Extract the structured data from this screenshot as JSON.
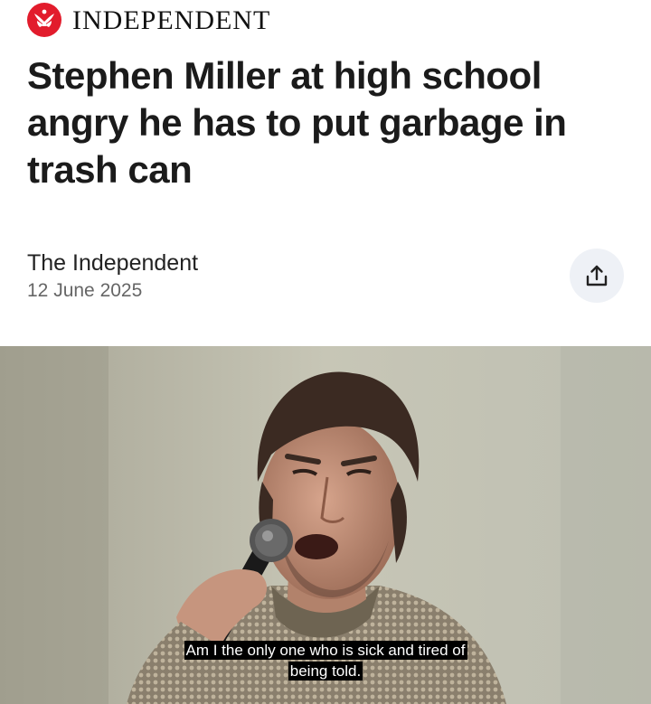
{
  "masthead": {
    "brand": "INDEPENDENT",
    "logo_icon": "eagle-logo-icon",
    "logo_color": "#e21c2c"
  },
  "article": {
    "headline": "Stephen Miller at high school angry he has to put garbage in trash can",
    "publisher": "The Independent",
    "date": "12 June 2025"
  },
  "actions": {
    "share_icon": "share-icon"
  },
  "video": {
    "subtitle_line1": "Am I the only one who is sick and tired of",
    "subtitle_line2": "being told."
  }
}
